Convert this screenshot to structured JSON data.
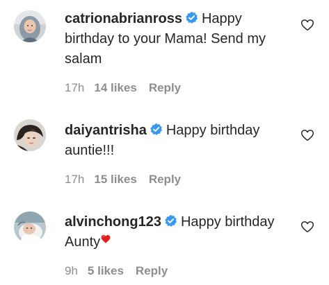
{
  "comments": [
    {
      "username": "catrionabrianross",
      "verified": true,
      "text": "Happy birthday to your Mama! Send my salam",
      "time": "17h",
      "likes": "14 likes",
      "reply": "Reply",
      "avatar_icon": "avatar-woman-hijab",
      "like_icon": "heart-outline-icon"
    },
    {
      "username": "daiyantrisha",
      "verified": true,
      "text": "Happy birthday auntie!!!",
      "time": "17h",
      "likes": "15 likes",
      "reply": "Reply",
      "avatar_icon": "avatar-woman-dark-hair",
      "like_icon": "heart-outline-icon"
    },
    {
      "username": "alvinchong123",
      "verified": true,
      "text": "Happy birthday Aunty",
      "text_emoji": "red-heart-emoji",
      "time": "9h",
      "likes": "5 likes",
      "reply": "Reply",
      "avatar_icon": "avatar-baby",
      "like_icon": "heart-outline-icon"
    }
  ],
  "colors": {
    "text": "#262626",
    "muted": "#8e8e8e",
    "verified_blue": "#3897f0",
    "emoji_red": "#e0201e"
  }
}
